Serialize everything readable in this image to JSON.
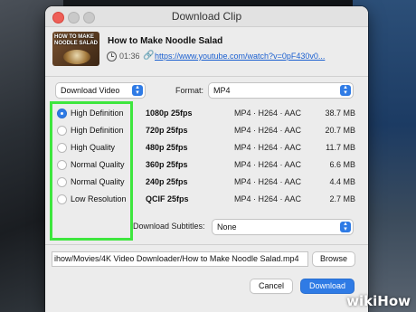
{
  "window": {
    "title": "Download Clip"
  },
  "video": {
    "thumbnail_text": "HOW TO MAKE NOODLE SALAD",
    "title": "How to Make Noodle Salad",
    "duration": "01:36",
    "url": "https://www.youtube.com/watch?v=0pF430v0..."
  },
  "download_type": {
    "selected": "Download Video"
  },
  "format": {
    "label": "Format:",
    "selected": "MP4"
  },
  "options": [
    {
      "label": "High Definition",
      "resolution": "1080p 25fps",
      "codec": "MP4 · H264 · AAC",
      "size": "38.7 MB",
      "selected": true
    },
    {
      "label": "High Definition",
      "resolution": "720p 25fps",
      "codec": "MP4 · H264 · AAC",
      "size": "20.7 MB",
      "selected": false
    },
    {
      "label": "High Quality",
      "resolution": "480p 25fps",
      "codec": "MP4 · H264 · AAC",
      "size": "11.7 MB",
      "selected": false
    },
    {
      "label": "Normal Quality",
      "resolution": "360p 25fps",
      "codec": "MP4 · H264 · AAC",
      "size": "6.6 MB",
      "selected": false
    },
    {
      "label": "Normal Quality",
      "resolution": "240p 25fps",
      "codec": "MP4 · H264 · AAC",
      "size": "4.4 MB",
      "selected": false
    },
    {
      "label": "Low Resolution",
      "resolution": "QCIF 25fps",
      "codec": "MP4 · H264 · AAC",
      "size": "2.7 MB",
      "selected": false
    }
  ],
  "subtitles": {
    "label": "Download Subtitles:",
    "selected": "None"
  },
  "save_path": {
    "value": "ihow/Movies/4K Video Downloader/How to Make Noodle Salad.mp4"
  },
  "buttons": {
    "browse": "Browse",
    "cancel": "Cancel",
    "download": "Download"
  },
  "watermark": {
    "wiki": "wiki",
    "how": "How"
  },
  "colors": {
    "accent": "#2f7be5",
    "highlight": "#3ee63e",
    "close": "#ee5f58"
  }
}
